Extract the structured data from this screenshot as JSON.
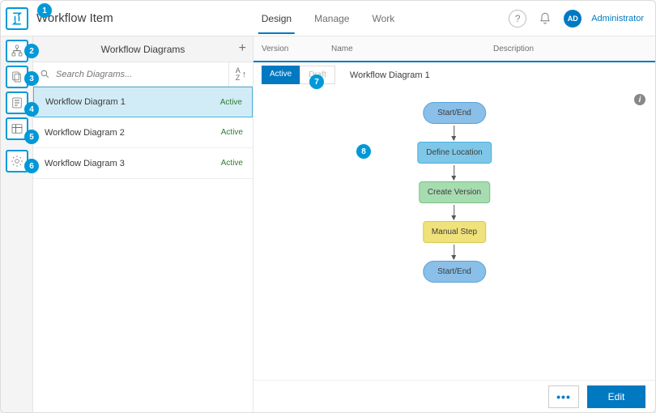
{
  "header": {
    "title": "Workflow Item",
    "tabs": [
      "Design",
      "Manage",
      "Work"
    ],
    "active_tab_index": 0,
    "user_initials": "AD",
    "user_name": "Administrator"
  },
  "rail_icons": [
    "diagram-tree-icon",
    "pages-icon",
    "form-icon",
    "grid-icon",
    "gear-icon"
  ],
  "panel": {
    "title": "Workflow Diagrams",
    "add_label": "+",
    "search_placeholder": "Search Diagrams...",
    "sort_label": "A↑Z",
    "items": [
      {
        "name": "Workflow Diagram 1",
        "status": "Active",
        "selected": true
      },
      {
        "name": "Workflow Diagram 2",
        "status": "Active",
        "selected": false
      },
      {
        "name": "Workflow Diagram 3",
        "status": "Active",
        "selected": false
      }
    ]
  },
  "main": {
    "columns": {
      "version": "Version",
      "name": "Name",
      "description": "Description"
    },
    "version_tabs": {
      "active": "Active",
      "draft": "Draft"
    },
    "row_name": "Workflow Diagram 1"
  },
  "flow_nodes": [
    {
      "label": "Start/End",
      "type": "oval"
    },
    {
      "label": "Define Location",
      "type": "box-blue"
    },
    {
      "label": "Create Version",
      "type": "box-green"
    },
    {
      "label": "Manual Step",
      "type": "box-yellow"
    },
    {
      "label": "Start/End",
      "type": "oval"
    }
  ],
  "footer": {
    "more": "•••",
    "edit": "Edit"
  },
  "callouts": [
    "1",
    "2",
    "3",
    "4",
    "5",
    "6",
    "7",
    "8"
  ]
}
